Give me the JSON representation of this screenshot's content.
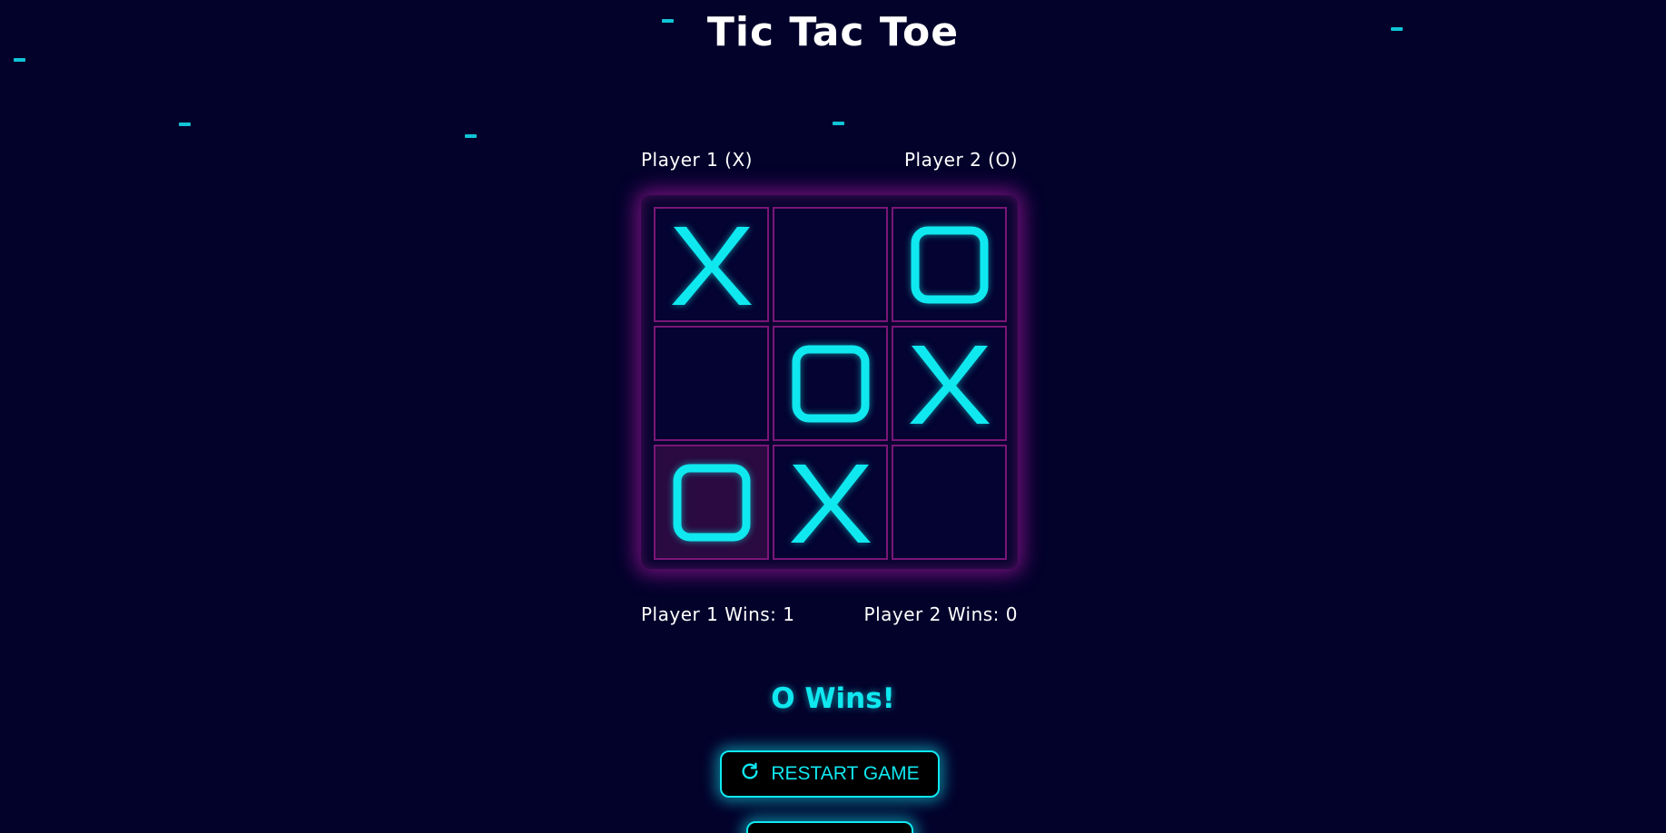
{
  "title": "Tic Tac Toe",
  "players": {
    "player1": "Player 1 (X)",
    "player2": "Player 2 (O)"
  },
  "board": {
    "cells": [
      "X",
      "",
      "O",
      "",
      "O",
      "X",
      "O",
      "X",
      ""
    ],
    "highlighted_cell": 6
  },
  "scores": {
    "player1": "Player 1 Wins: 1",
    "player2": "Player 2 Wins: 0"
  },
  "result": "O Wins!",
  "buttons": {
    "restart_label": "RESTART GAME",
    "restart_icon": "refresh-icon"
  },
  "colors": {
    "background": "#03022b",
    "accent": "#10e8f0",
    "grid": "#7a1678"
  }
}
